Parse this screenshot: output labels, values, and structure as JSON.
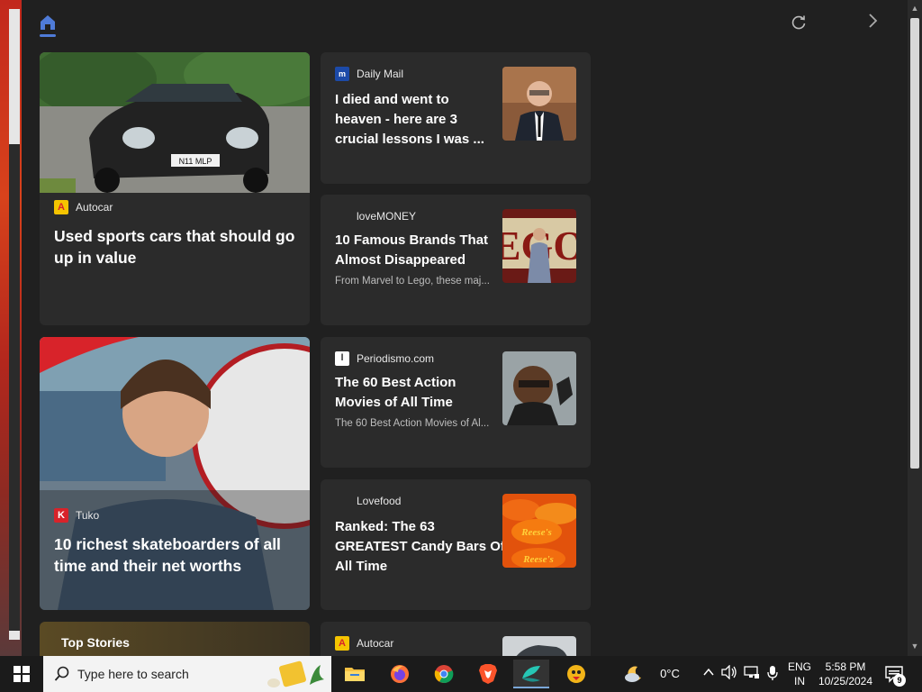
{
  "cards": [
    {
      "source": "Autocar",
      "headline": "Used sports cars that should go up in value"
    },
    {
      "source": "Daily Mail",
      "headline": "I died and went to heaven - here are 3 crucial lessons I was ..."
    },
    {
      "source": "loveMONEY",
      "headline": "10 Famous Brands That Almost Disappeared",
      "summary": "From Marvel to Lego, these maj..."
    },
    {
      "source": "Tuko",
      "headline": "10 richest skateboarders of all time and their net worths"
    },
    {
      "source": "Periodismo.com",
      "headline": "The 60 Best Action Movies of All Time",
      "summary": "The 60 Best Action Movies of Al..."
    },
    {
      "source": "Lovefood",
      "headline": "Ranked: The 63 GREATEST Candy Bars Of All Time"
    },
    {
      "source": "Autocar"
    }
  ],
  "top_stories": {
    "label": "Top Stories"
  },
  "plate_text": "N11 MLP",
  "taskbar": {
    "search_placeholder": "Type here to search",
    "weather": "0°C",
    "lang_top": "ENG",
    "lang_bottom": "IN",
    "time": "5:58 PM",
    "date": "10/25/2024",
    "notification_count": "9"
  },
  "colors": {
    "accent": "#4f7bd8",
    "autocar": "#f5c400",
    "tuko": "#d8232a"
  }
}
